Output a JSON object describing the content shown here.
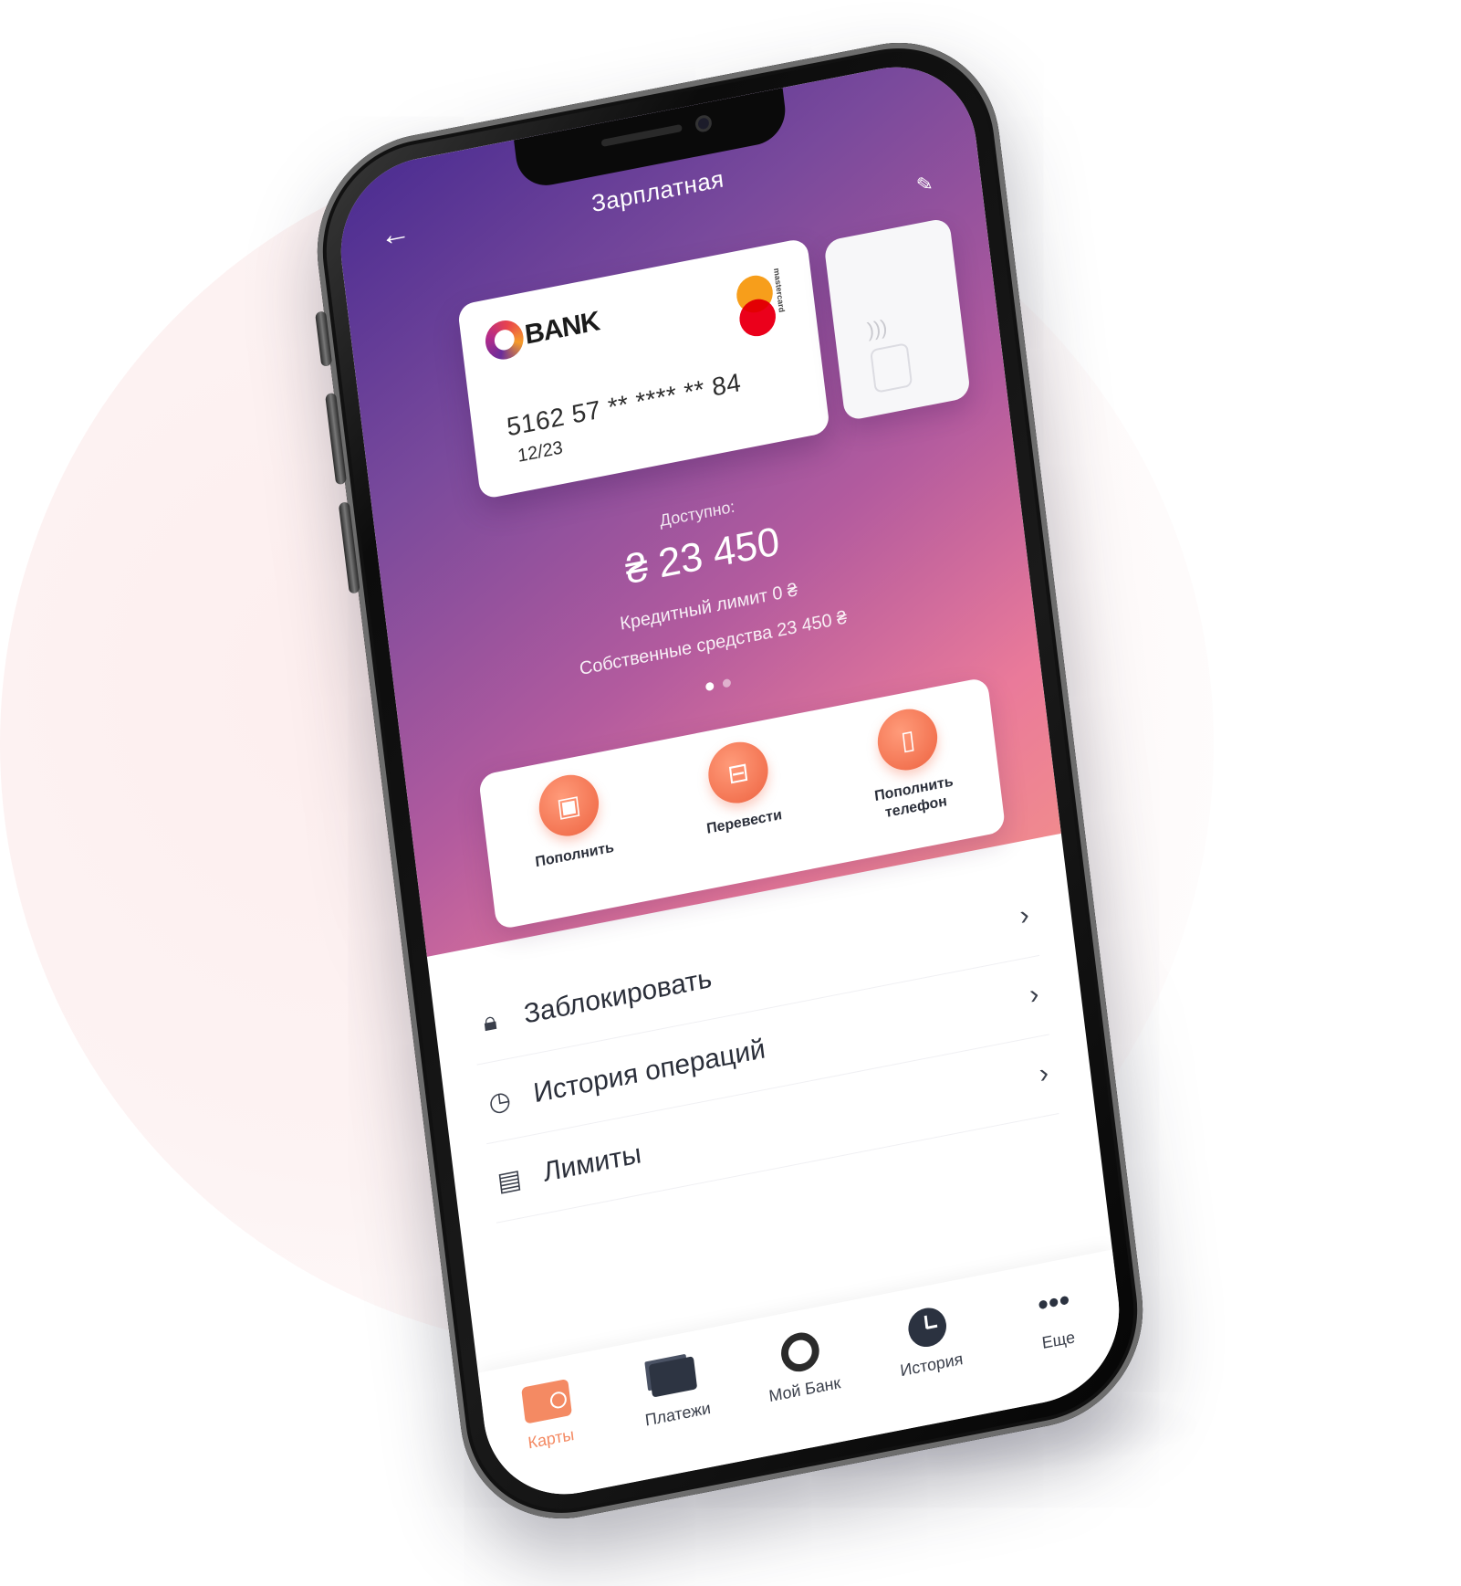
{
  "screen": {
    "title": "Зарплатная",
    "back_icon": "arrow-left-icon",
    "edit_icon": "pencil-icon"
  },
  "card": {
    "brand": "BANK",
    "network": "mastercard",
    "number": "5162 57 **  ****  ** 84",
    "expiry": "12/23"
  },
  "balance": {
    "label": "Доступно:",
    "amount": "₴ 23 450",
    "credit_limit": "Кредитный лимит 0 ₴",
    "own_funds": "Собственные средства 23 450 ₴"
  },
  "pager": {
    "count": 2,
    "active_index": 0
  },
  "actions": [
    {
      "label": "Пополнить",
      "icon": "card-topup-icon"
    },
    {
      "label": "Перевести",
      "icon": "money-transfer-icon"
    },
    {
      "label": "Пополнить телефон",
      "icon": "phone-icon"
    }
  ],
  "menu": [
    {
      "label": "Заблокировать",
      "icon": "lock-icon"
    },
    {
      "label": "История операций",
      "icon": "clock-icon"
    },
    {
      "label": "Лимиты",
      "icon": "documents-icon"
    }
  ],
  "tabbar": [
    {
      "label": "Карты",
      "icon": "wallet-icon",
      "active": true
    },
    {
      "label": "Платежи",
      "icon": "cards-icon",
      "active": false
    },
    {
      "label": "Мой Банк",
      "icon": "mybank-icon",
      "active": false
    },
    {
      "label": "История",
      "icon": "clock-icon",
      "active": false
    },
    {
      "label": "Еще",
      "icon": "more-icon",
      "active": false
    }
  ],
  "colors": {
    "hero_start": "#4a2c91",
    "hero_end": "#f08a8e",
    "accent": "#f37452",
    "text_dark": "#2b2f3a"
  }
}
